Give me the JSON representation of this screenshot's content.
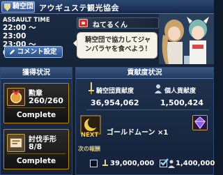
{
  "header": {
    "guild_tag": "騎空団",
    "guild_name": "アウギュステ観光協会"
  },
  "assault_time": {
    "title": "ASSAULT TIME",
    "slots": [
      "22:00 ～ 23:00",
      "23:00 ～ 0:00"
    ]
  },
  "comment_button": {
    "label": "コメント設定",
    "icon": "pencil-icon"
  },
  "chat": {
    "user_name": "ねてるくん",
    "message_line1": "騎空団で協力してジャ",
    "message_line2": "ンバラヤを食べよう！"
  },
  "acquisition": {
    "title": "獲得状況",
    "cards": [
      {
        "label": "勲章",
        "count": "260/260",
        "status": "Complete",
        "icon": "medal-icon",
        "progress": 1.0
      },
      {
        "label": "討伐手形",
        "count": "8/8",
        "status": "Complete",
        "icon": "ticket-icon",
        "progress": 1.0
      }
    ]
  },
  "contribution": {
    "title": "貢献度状況",
    "crew_label": "騎空団貢献度",
    "crew_value": "36,954,062",
    "personal_label": "個人貢献度",
    "personal_value": "1,500,424",
    "next_reward": {
      "tag": "NEXT",
      "name": "ゴールドムーン ×1",
      "icon": "gold-moon-icon"
    },
    "next_reward_label": "次の報酬",
    "thresholds": [
      {
        "value": "39,000,000",
        "checked": false
      },
      {
        "value": "1,400,000",
        "checked": true
      }
    ]
  },
  "colors": {
    "accent_gold": "#b8860b",
    "panel_blue": "#213a5e"
  }
}
